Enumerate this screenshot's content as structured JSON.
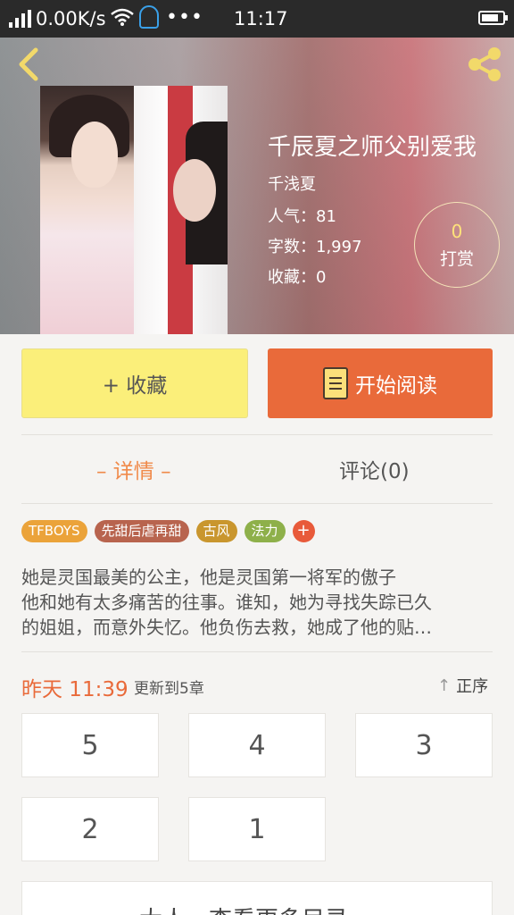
{
  "status_bar": {
    "network_speed": "0.00K/s",
    "more_glyph": "•••",
    "time": "11:17"
  },
  "header": {
    "book_title": "千辰夏之师父别爱我",
    "author": "千浅夏",
    "popularity": "人气：81",
    "word_count": "字数：1,997",
    "favorites": "收藏：0",
    "reward_count": "0",
    "reward_label": "打赏"
  },
  "actions": {
    "favorite_label": "+ 收藏",
    "read_label": "开始阅读"
  },
  "tabs": {
    "detail": "– 详情 –",
    "comments": "评论(0)"
  },
  "tags": [
    {
      "label": "TFBOYS",
      "color": "#eba33a"
    },
    {
      "label": "先甜后虐再甜",
      "color": "#b8644e"
    },
    {
      "label": "古风",
      "color": "#c9962e"
    },
    {
      "label": "法力",
      "color": "#8eb04a"
    }
  ],
  "tag_add_label": "+",
  "synopsis": {
    "line1": "她是灵国最美的公主，他是灵国第一将军的傲子",
    "line2": "他和她有太多痛苦的往事。谁知，她为寻找失踪已久",
    "line3": "的姐姐，而意外失忆。他负伤去救，她成了他的贴…"
  },
  "update": {
    "time": "昨天 11:39",
    "text": "更新到5章",
    "sort_label": "正序"
  },
  "chapters": [
    "5",
    "4",
    "3",
    "2",
    "1"
  ],
  "more_catalog": "大人，查看更多目录 ⌄",
  "colors": {
    "accent_orange": "#e96a3a",
    "favorite_yellow": "#fbef7a",
    "tab_active": "#f08a4a"
  }
}
